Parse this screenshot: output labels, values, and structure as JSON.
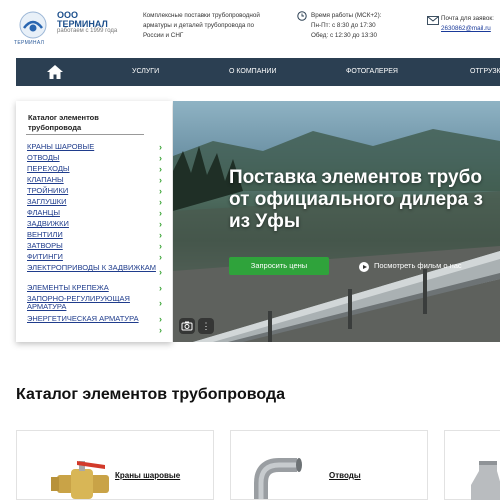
{
  "header": {
    "logo_caption": "ТЕРМИНАЛ",
    "brand_line1": "ООО",
    "brand_line2": "ТЕРМИНАЛ",
    "brand_since": "работаем с 1999 года",
    "tagline_1": "Комплексные поставки трубопроводной",
    "tagline_2": "арматуры и деталей трубопровода по",
    "tagline_3": "России и СНГ",
    "hours_1": "Время работы (МСК+2):",
    "hours_2": "Пн-Пт: с 8:30 до 17:30",
    "hours_3": "Обед: с 12:30 до 13:30",
    "mail_label": "Почта для заявок:",
    "mail_address": "2630862@mail.ru"
  },
  "nav": {
    "items": [
      "УСЛУГИ",
      "О КОМПАНИИ",
      "ФОТОГАЛЕРЕЯ",
      "ОТГРУЗКИ"
    ]
  },
  "sidebar": {
    "title": "Каталог элементов трубопровода",
    "items": [
      "КРАНЫ ШАРОВЫЕ",
      "ОТВОДЫ",
      "ПЕРЕХОДЫ",
      "КЛАПАНЫ",
      "ТРОЙНИКИ",
      "ЗАГЛУШКИ",
      "ФЛАНЦЫ",
      "ЗАДВИЖКИ",
      "ВЕНТИЛИ",
      "ЗАТВОРЫ",
      "ФИТИНГИ",
      "ЭЛЕКТРОПРИВОДЫ К ЗАДВИЖКАМ",
      "ЭЛЕМЕНТЫ КРЕПЕЖА",
      "ЗАПОРНО-РЕГУЛИРУЮЩАЯ АРМАТУРА",
      "ЭНЕРГЕТИЧЕСКАЯ АРМАТУРА"
    ]
  },
  "hero": {
    "title_1": "Поставка элементов трубо",
    "title_2": "от официального дилера з",
    "title_3": "из Уфы",
    "cta": "Запросить цены",
    "video_link": "Посмотреть фильм о нас"
  },
  "section": {
    "title": "Каталог элементов трубопровода",
    "cards": [
      "Краны шаровые",
      "Отводы"
    ]
  },
  "colors": {
    "nav_bg": "#2b3f52",
    "cta_green": "#2fa33b",
    "link_blue": "#1f3c8c",
    "chevron_green": "#3aa335"
  }
}
